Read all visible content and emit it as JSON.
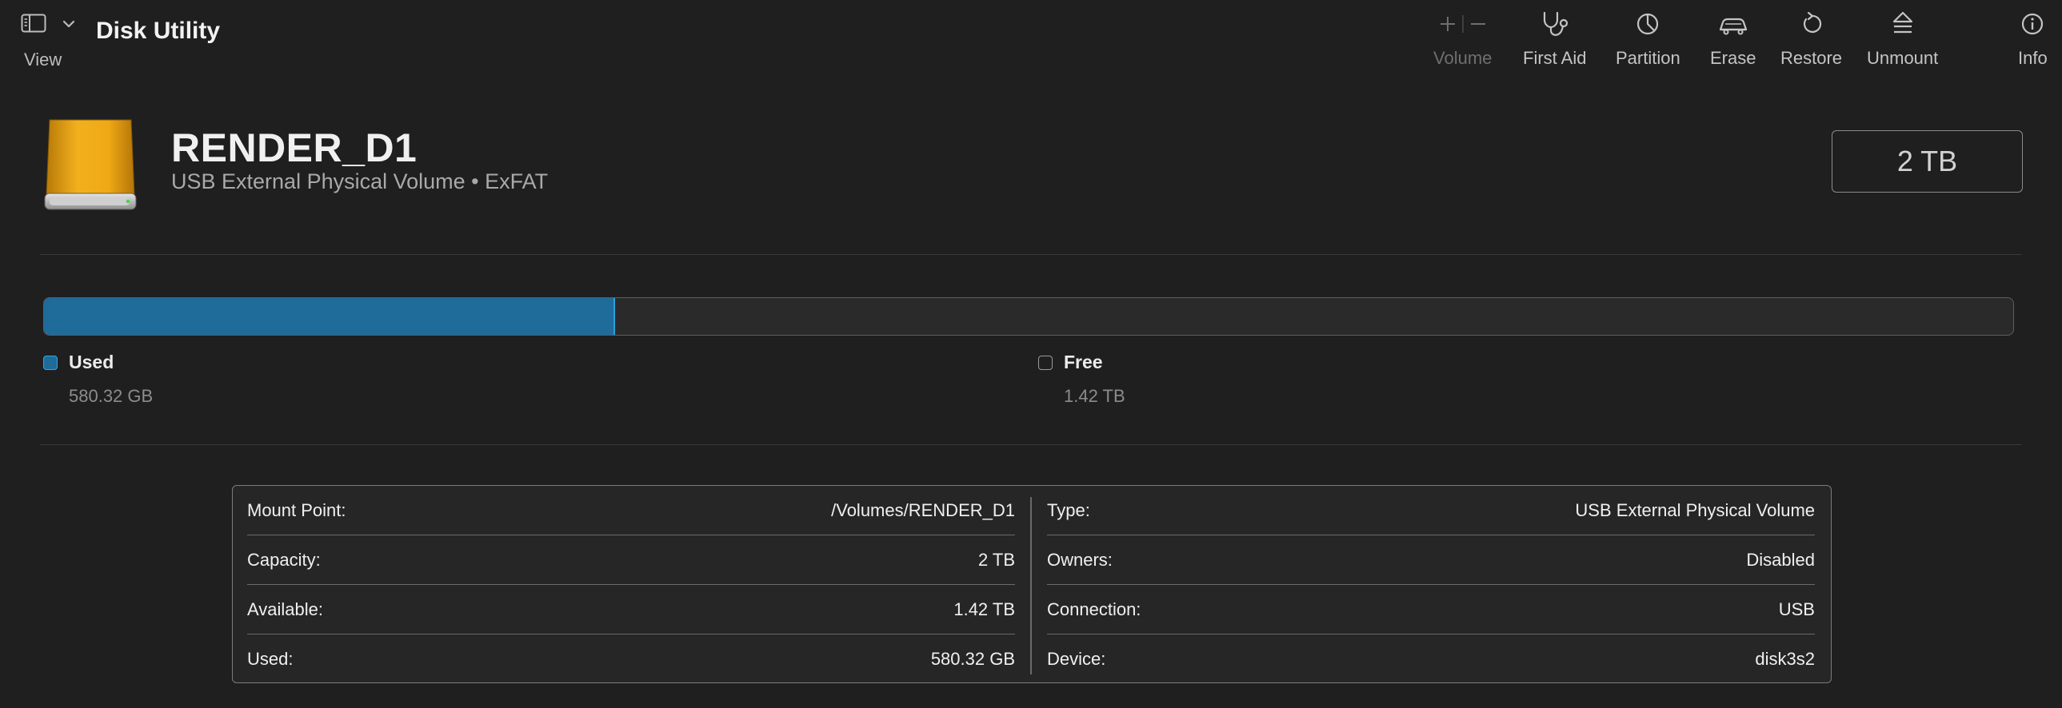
{
  "app": {
    "title": "Disk Utility"
  },
  "toolbar": {
    "view_label": "View",
    "buttons": [
      {
        "id": "volume",
        "label": "Volume",
        "icon": "plus-minus-icon",
        "enabled": false
      },
      {
        "id": "first_aid",
        "label": "First Aid",
        "icon": "stethoscope-icon",
        "enabled": true
      },
      {
        "id": "partition",
        "label": "Partition",
        "icon": "pie-chart-icon",
        "enabled": true
      },
      {
        "id": "erase",
        "label": "Erase",
        "icon": "eraser-car-icon",
        "enabled": true
      },
      {
        "id": "restore",
        "label": "Restore",
        "icon": "restore-arrow-icon",
        "enabled": true
      },
      {
        "id": "unmount",
        "label": "Unmount",
        "icon": "eject-icon",
        "enabled": true
      },
      {
        "id": "info",
        "label": "Info",
        "icon": "info-circle-icon",
        "enabled": true
      }
    ]
  },
  "volume": {
    "name": "RENDER_D1",
    "description": "USB External Physical Volume • ExFAT",
    "capacity": "2 TB",
    "icon": "external-drive-icon"
  },
  "usage": {
    "used_fraction": 0.29,
    "used_label": "Used",
    "used_amount": "580.32 GB",
    "free_label": "Free",
    "free_amount": "1.42 TB",
    "colors": {
      "used": "#1f6b9a",
      "used_border": "#2b9fe0"
    }
  },
  "info": {
    "left": [
      {
        "key": "Mount Point:",
        "value": "/Volumes/RENDER_D1"
      },
      {
        "key": "Capacity:",
        "value": "2 TB"
      },
      {
        "key": "Available:",
        "value": "1.42 TB"
      },
      {
        "key": "Used:",
        "value": "580.32 GB"
      }
    ],
    "right": [
      {
        "key": "Type:",
        "value": "USB External Physical Volume"
      },
      {
        "key": "Owners:",
        "value": "Disabled"
      },
      {
        "key": "Connection:",
        "value": "USB"
      },
      {
        "key": "Device:",
        "value": "disk3s2"
      }
    ]
  }
}
